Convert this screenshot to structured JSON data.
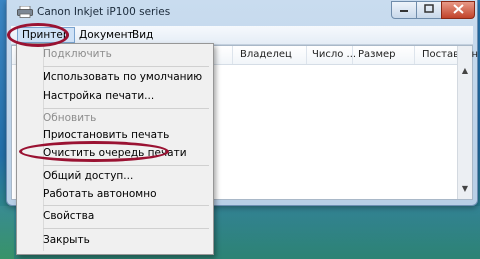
{
  "window": {
    "title": "Canon Inkjet iP100 series"
  },
  "menubar": {
    "items": [
      "Принтер",
      "Документ",
      "Вид"
    ]
  },
  "columns": [
    "Владелец",
    "Число ...",
    "Размер",
    "Поставлен"
  ],
  "dropdown": {
    "items": [
      {
        "label": "Подключить",
        "enabled": false
      },
      {
        "label": "Использовать по умолчанию",
        "enabled": true
      },
      {
        "label": "Настройка печати...",
        "enabled": true
      },
      {
        "label": "Обновить",
        "enabled": false
      },
      {
        "label": "Приостановить печать",
        "enabled": true
      },
      {
        "label": "Очистить очередь печати",
        "enabled": true
      },
      {
        "label": "Общий доступ...",
        "enabled": true
      },
      {
        "label": "Работать автономно",
        "enabled": true
      },
      {
        "label": "Свойства",
        "enabled": true
      },
      {
        "label": "Закрыть",
        "enabled": true
      }
    ]
  },
  "annotations": {
    "highlight_color": "#9a1232"
  },
  "icons": {
    "app": "printer-icon",
    "minimize": "minimize-icon",
    "maximize": "maximize-icon",
    "close": "close-icon"
  }
}
